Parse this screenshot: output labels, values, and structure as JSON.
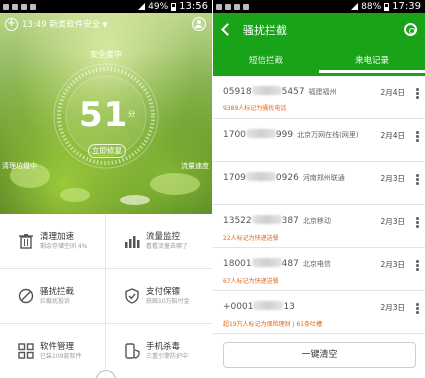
{
  "left": {
    "status_time": "13:56",
    "status_battery": "49%",
    "header_title": "13:49 新类软件安全",
    "safety_label": "安全度中",
    "score": "51",
    "score_unit": "分",
    "fix_button": "立即修复",
    "side_left": "清理垃圾中",
    "side_right": "流量速度",
    "grid": [
      {
        "icon": "trash-icon",
        "title": "清理加速",
        "sub": "剩余存储空间 4%"
      },
      {
        "icon": "bar-chart-icon",
        "title": "流量监控",
        "sub": "看看流量去哪了"
      },
      {
        "icon": "block-icon",
        "title": "骚扰拦截",
        "sub": "拦截扰投诉"
      },
      {
        "icon": "shield-check-icon",
        "title": "支付保镖",
        "sub": "获赔10万赔付金"
      },
      {
        "icon": "apps-icon",
        "title": "软件管理",
        "sub": "已装109款软件"
      },
      {
        "icon": "phone-shield-icon",
        "title": "手机杀毒",
        "sub": "三重引擎防护中"
      }
    ]
  },
  "right": {
    "status_time": "17:39",
    "status_battery": "88%",
    "title": "骚扰拦截",
    "tabs": [
      "短信拦截",
      "来电记录"
    ],
    "records": [
      {
        "num_a": "05918",
        "num_b": "5457",
        "location": "福建福州",
        "date": "2月4日",
        "tag": "9389人标记为骚扰电话"
      },
      {
        "num_a": "1700",
        "num_b": "999",
        "location": "北京万网在线(网里)",
        "date": "2月4日",
        "tag": ""
      },
      {
        "num_a": "1709",
        "num_b": "0926",
        "location": "河南郑州联通",
        "date": "2月3日",
        "tag": ""
      },
      {
        "num_a": "13522",
        "num_b": "387",
        "location": "北京移动",
        "date": "2月3日",
        "tag": "22人标记为快递送餐"
      },
      {
        "num_a": "18001",
        "num_b": "487",
        "location": "北京电信",
        "date": "2月3日",
        "tag": "67人标记为快递送餐"
      },
      {
        "num_a": "+0001",
        "num_b": "13",
        "location": "",
        "date": "2月3日",
        "tag": "超19万人标记为保险理财 | 61条吐槽"
      }
    ],
    "clear_button": "一键清空"
  }
}
